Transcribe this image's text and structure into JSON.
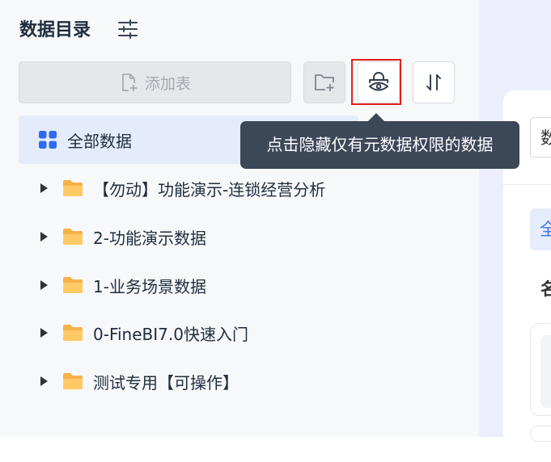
{
  "header": {
    "title": "数据目录",
    "filter_icon": "sliders-icon"
  },
  "toolbar": {
    "add_table_label": "添加表",
    "add_table_icon": "add-file-icon",
    "new_folder_icon": "add-folder-icon",
    "hide_permission_icon": "lock-eye-icon",
    "sort_icon": "sort-arrows-icon"
  },
  "tooltip": {
    "text": "点击隐藏仅有元数据权限的数据"
  },
  "tree": {
    "root_label": "全部数据",
    "items": [
      {
        "label": "【勿动】功能演示-连锁经营分析"
      },
      {
        "label": "2-功能演示数据"
      },
      {
        "label": "1-业务场景数据"
      },
      {
        "label": "0-FineBI7.0快速入门"
      },
      {
        "label": "测试专用【可操作】"
      }
    ]
  },
  "right_panel": {
    "input_text": "数",
    "tab_text": "全",
    "label_text": "名"
  },
  "colors": {
    "accent": "#3d6fe0",
    "folder": "#f7b84a",
    "tooltip_bg": "#3c4758",
    "highlight": "#e02020"
  }
}
